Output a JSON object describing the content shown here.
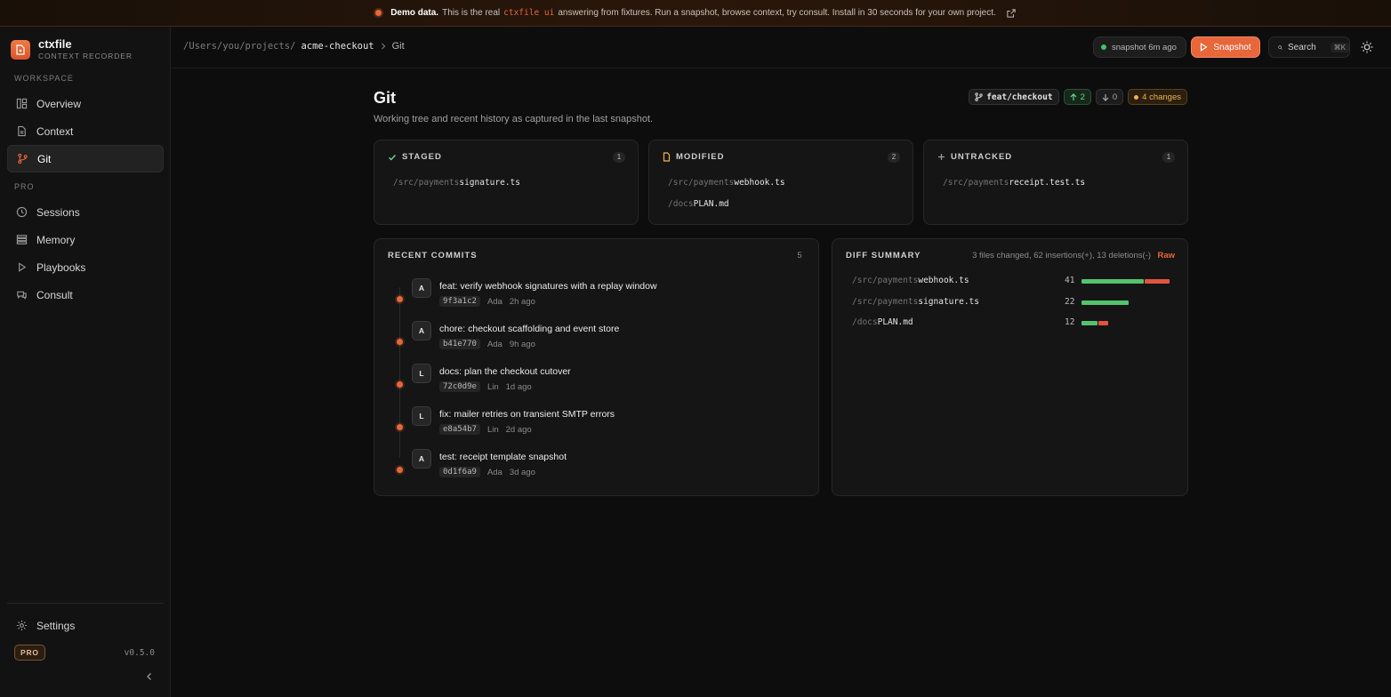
{
  "banner": {
    "label": "Demo data.",
    "text_before": "This is the real",
    "code": "ctxfile ui",
    "text_after": "answering from fixtures. Run a snapshot, browse context, try consult. Install in 30 seconds for your own project."
  },
  "brand": {
    "name": "ctxfile",
    "subtitle": "CONTEXT RECORDER"
  },
  "sidebar": {
    "workspace_label": "WORKSPACE",
    "pro_label": "PRO",
    "workspace_items": [
      {
        "label": "Overview",
        "icon": "layout-icon"
      },
      {
        "label": "Context",
        "icon": "file-icon"
      },
      {
        "label": "Git",
        "icon": "branch-icon",
        "active": true
      }
    ],
    "pro_items": [
      {
        "label": "Sessions",
        "icon": "clock-icon"
      },
      {
        "label": "Memory",
        "icon": "layers-icon"
      },
      {
        "label": "Playbooks",
        "icon": "play-icon"
      },
      {
        "label": "Consult",
        "icon": "chat-icon"
      }
    ],
    "settings_label": "Settings",
    "plan_badge": "PRO",
    "version": "v0.5.0"
  },
  "topbar": {
    "path": "/Users/you/projects/",
    "project": "acme-checkout",
    "page": "Git",
    "snapshot_status": "snapshot 6m ago",
    "snapshot_button": "Snapshot",
    "search_label": "Search",
    "search_shortcut": "⌘K"
  },
  "page": {
    "title": "Git",
    "subtitle": "Working tree and recent history as captured in the last snapshot.",
    "branch": "feat/checkout",
    "ahead": "2",
    "behind": "0",
    "changes": "4 changes"
  },
  "staged": {
    "title": "STAGED",
    "count": "1",
    "files": [
      {
        "dir": "/src/payments",
        "name": "signature.ts"
      }
    ]
  },
  "modified": {
    "title": "MODIFIED",
    "count": "2",
    "files": [
      {
        "dir": "/src/payments",
        "name": "webhook.ts"
      },
      {
        "dir": "/docs",
        "name": "PLAN.md"
      }
    ]
  },
  "untracked": {
    "title": "UNTRACKED",
    "count": "1",
    "files": [
      {
        "dir": "/src/payments",
        "name": "receipt.test.ts"
      }
    ]
  },
  "commits": {
    "title": "RECENT COMMITS",
    "count": "5",
    "items": [
      {
        "avatar": "A",
        "message": "feat: verify webhook signatures with a replay window",
        "hash": "9f3a1c2",
        "author": "Ada",
        "time": "2h ago"
      },
      {
        "avatar": "A",
        "message": "chore: checkout scaffolding and event store",
        "hash": "b41e770",
        "author": "Ada",
        "time": "9h ago"
      },
      {
        "avatar": "L",
        "message": "docs: plan the checkout cutover",
        "hash": "72c0d9e",
        "author": "Lin",
        "time": "1d ago"
      },
      {
        "avatar": "L",
        "message": "fix: mailer retries on transient SMTP errors",
        "hash": "e8a54b7",
        "author": "Lin",
        "time": "2d ago"
      },
      {
        "avatar": "A",
        "message": "test: receipt template snapshot",
        "hash": "0d1f6a9",
        "author": "Ada",
        "time": "3d ago"
      }
    ]
  },
  "diff": {
    "title": "DIFF SUMMARY",
    "summary": "3 files changed, 62 insertions(+), 13 deletions(-)",
    "raw_label": "Raw",
    "files": [
      {
        "dir": "/src/payments",
        "name": "webhook.ts",
        "lines": "41",
        "add_fraction": 0.71,
        "del_fraction": 0.29
      },
      {
        "dir": "/src/payments",
        "name": "signature.ts",
        "lines": "22",
        "add_fraction": 1.0,
        "del_fraction": 0.0
      },
      {
        "dir": "/docs",
        "name": "PLAN.md",
        "lines": "12",
        "add_fraction": 0.62,
        "del_fraction": 0.38
      }
    ]
  },
  "colors": {
    "accent": "#e8663a",
    "success": "#53c36e",
    "danger": "#e2553e",
    "warning": "#f0b24a"
  }
}
